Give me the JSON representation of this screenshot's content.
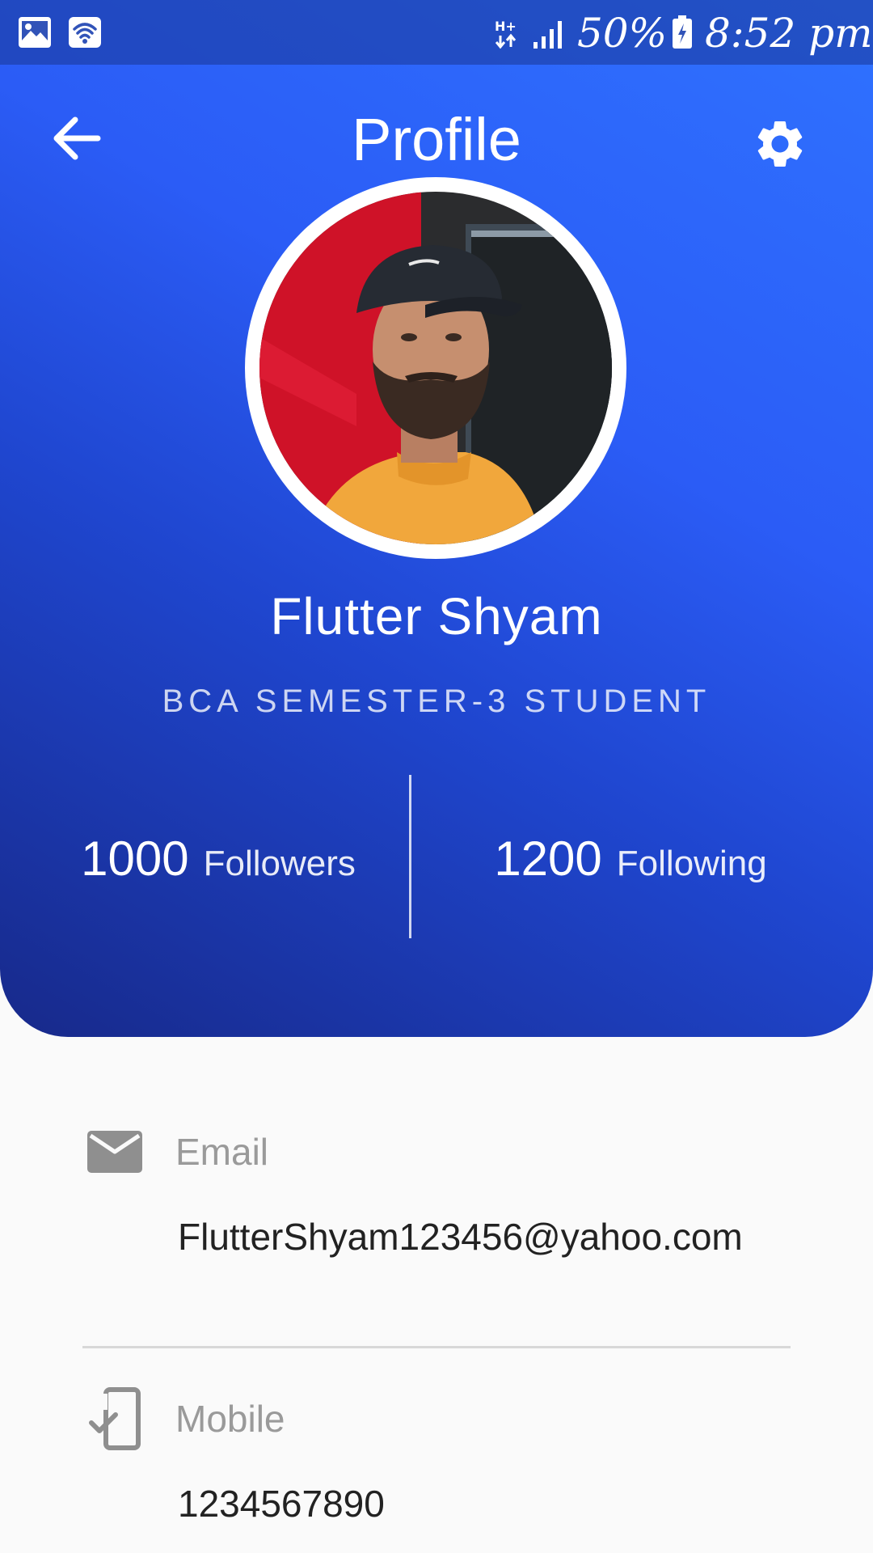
{
  "status_bar": {
    "icons": [
      "gallery-icon",
      "wifi-icon",
      "hplus-data-icon",
      "signal-icon",
      "battery-charging-icon"
    ],
    "battery_text": "50%",
    "time_text": "8:52 pm"
  },
  "header": {
    "back_icon": "arrow-back-icon",
    "title": "Profile",
    "settings_icon": "gear-icon"
  },
  "profile": {
    "avatar": "profile-photo",
    "name": "Flutter Shyam",
    "role": "BCA SEMESTER-3 STUDENT"
  },
  "stats": {
    "followers": {
      "count": "1000",
      "label": "Followers"
    },
    "following": {
      "count": "1200",
      "label": "Following"
    }
  },
  "info": {
    "email": {
      "icon": "mail-icon",
      "label": "Email",
      "value": "FlutterShyam123456@yahoo.com"
    },
    "mobile": {
      "icon": "phone-check-icon",
      "label": "Mobile",
      "value": "1234567890"
    }
  },
  "colors": {
    "header_gradient": [
      "#2f72ff",
      "#2b5cf6",
      "#1f46cf",
      "#17298a"
    ],
    "background": "#fafafa",
    "label_gray": "#9a9a9a",
    "icon_gray": "#8f8f8f",
    "text_dark": "#222222"
  }
}
